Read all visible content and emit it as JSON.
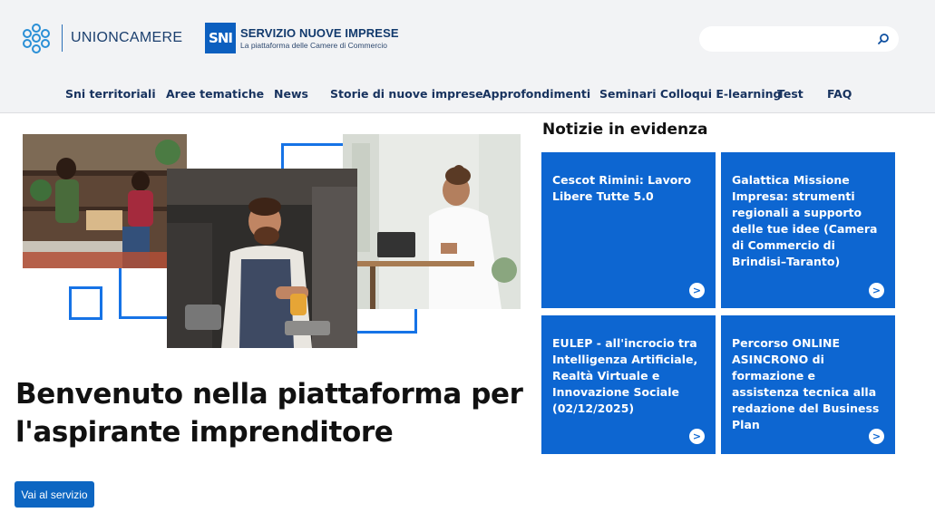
{
  "header": {
    "brand_name": "UNIONCAMERE",
    "sni_logo_text": "SNI",
    "sni_title": "SERVIZIO NUOVE IMPRESE",
    "sni_subtitle": "La piattaforma delle Camere di Commercio",
    "search": {
      "value": "",
      "placeholder": ""
    }
  },
  "nav": {
    "items": [
      {
        "label": "Sni territoriali"
      },
      {
        "label": "Aree tematiche"
      },
      {
        "label": "News"
      },
      {
        "label": "Storie di nuove imprese"
      },
      {
        "label": "Approfondimenti"
      },
      {
        "label": "Seminari Colloqui E-learning"
      },
      {
        "label": "Test"
      },
      {
        "label": "FAQ"
      }
    ]
  },
  "hero": {
    "title_line1": "Benvenuto nella piattaforma per",
    "title_line2": "l'aspirante imprenditore",
    "cta_label": "Vai al servizio"
  },
  "news": {
    "heading": "Notizie in evidenza",
    "cards": [
      {
        "title": "Cescot Rimini: Lavoro Libere Tutte 5.0"
      },
      {
        "title": "Galattica Missione Impresa: strumenti regionali a supporto delle tue idee (Camera di Commercio di Brindisi–Taranto)"
      },
      {
        "title": "EULEP - all'incrocio tra Intelligenza Artificiale, Realtà Virtuale e Innovazione Sociale (02/12/2025)"
      },
      {
        "title": "Percorso ONLINE ASINCRONO di formazione e assistenza tecnica alla redazione del Business Plan"
      }
    ],
    "arrow_glyph": ">"
  },
  "colors": {
    "accent": "#0d66d1",
    "nav_text": "#17325e",
    "header_bg": "#f2f3f5",
    "frame_blue": "#1673e6"
  }
}
